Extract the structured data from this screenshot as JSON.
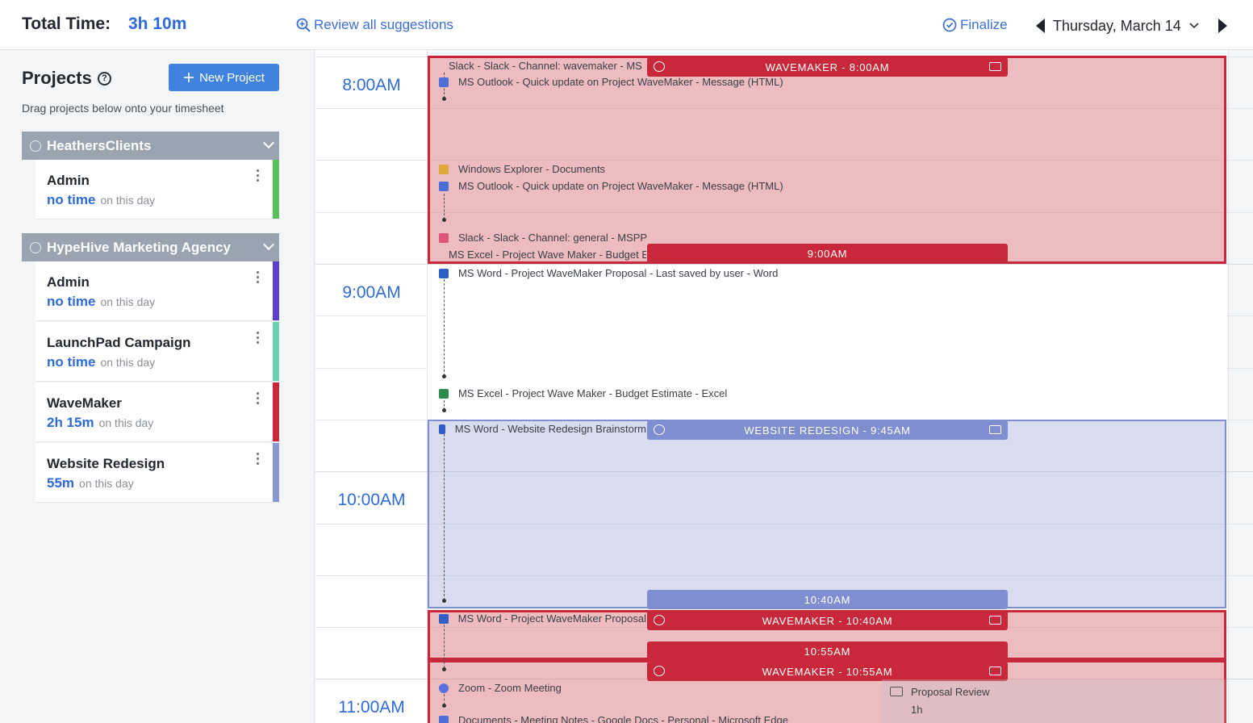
{
  "header": {
    "total_label": "Total Time:",
    "total_value": "3h 10m",
    "review_label": "Review all suggestions",
    "finalize_label": "Finalize",
    "date_label": "Thursday, March 14"
  },
  "sidebar": {
    "title": "Projects",
    "help_glyph": "?",
    "new_project_label": "New Project",
    "drag_hint": "Drag projects below onto your timesheet",
    "groups": [
      {
        "name": "HeathersClients",
        "projects": [
          {
            "name": "Admin",
            "time": "no time",
            "suffix": "on this day",
            "color": "#5bbf5a"
          }
        ]
      },
      {
        "name": "HypeHive Marketing Agency",
        "projects": [
          {
            "name": "Admin",
            "time": "no time",
            "suffix": "on this day",
            "color": "#5b3fc8"
          },
          {
            "name": "LaunchPad Campaign",
            "time": "no time",
            "suffix": "on this day",
            "color": "#6ccfb4"
          },
          {
            "name": "WaveMaker",
            "time": "2h 15m",
            "suffix": "on this day",
            "color": "#c8283a"
          },
          {
            "name": "Website Redesign",
            "time": "55m",
            "suffix": "on this day",
            "color": "#8a96d2"
          }
        ]
      }
    ]
  },
  "timeline": {
    "hours": [
      "8:00AM",
      "9:00AM",
      "10:00AM",
      "11:00AM"
    ],
    "pills": {
      "wavemaker_800": "WAVEMAKER - 8:00AM",
      "end_900": "9:00AM",
      "website_945": "WEBSITE REDESIGN - 9:45AM",
      "end_1040": "10:40AM",
      "wavemaker_1040": "WAVEMAKER - 10:40AM",
      "end_1055": "10:55AM",
      "wavemaker_1055": "WAVEMAKER - 10:55AM"
    },
    "activities": [
      "Slack - Slack - Channel: wavemaker - MSPP",
      "MS Outlook - Quick update on Project WaveMaker - Message (HTML)",
      "Windows Explorer - Documents",
      "MS Outlook - Quick update on Project WaveMaker - Message (HTML)",
      "Slack - Slack - Channel: general - MSPP",
      "MS Excel - Project Wave Maker - Budget Estimate - Excel",
      "MS Word - Project WaveMaker Proposal - Last saved by user - Word",
      "MS Excel - Project Wave Maker - Budget Estimate - Excel",
      "MS Word - Website Redesign Brainstorm",
      "MS Word - Project WaveMaker Proposal",
      "Zoom - Zoom Meeting",
      "Documents - Meeting Notes - Google Docs - Personal - Microsoft Edge"
    ],
    "meeting": {
      "title": "Proposal Review",
      "duration": "1h"
    }
  },
  "colors": {
    "accent": "#2f6bd8",
    "wavemaker": "#c8283a",
    "website_redesign": "#7f8ed0"
  }
}
